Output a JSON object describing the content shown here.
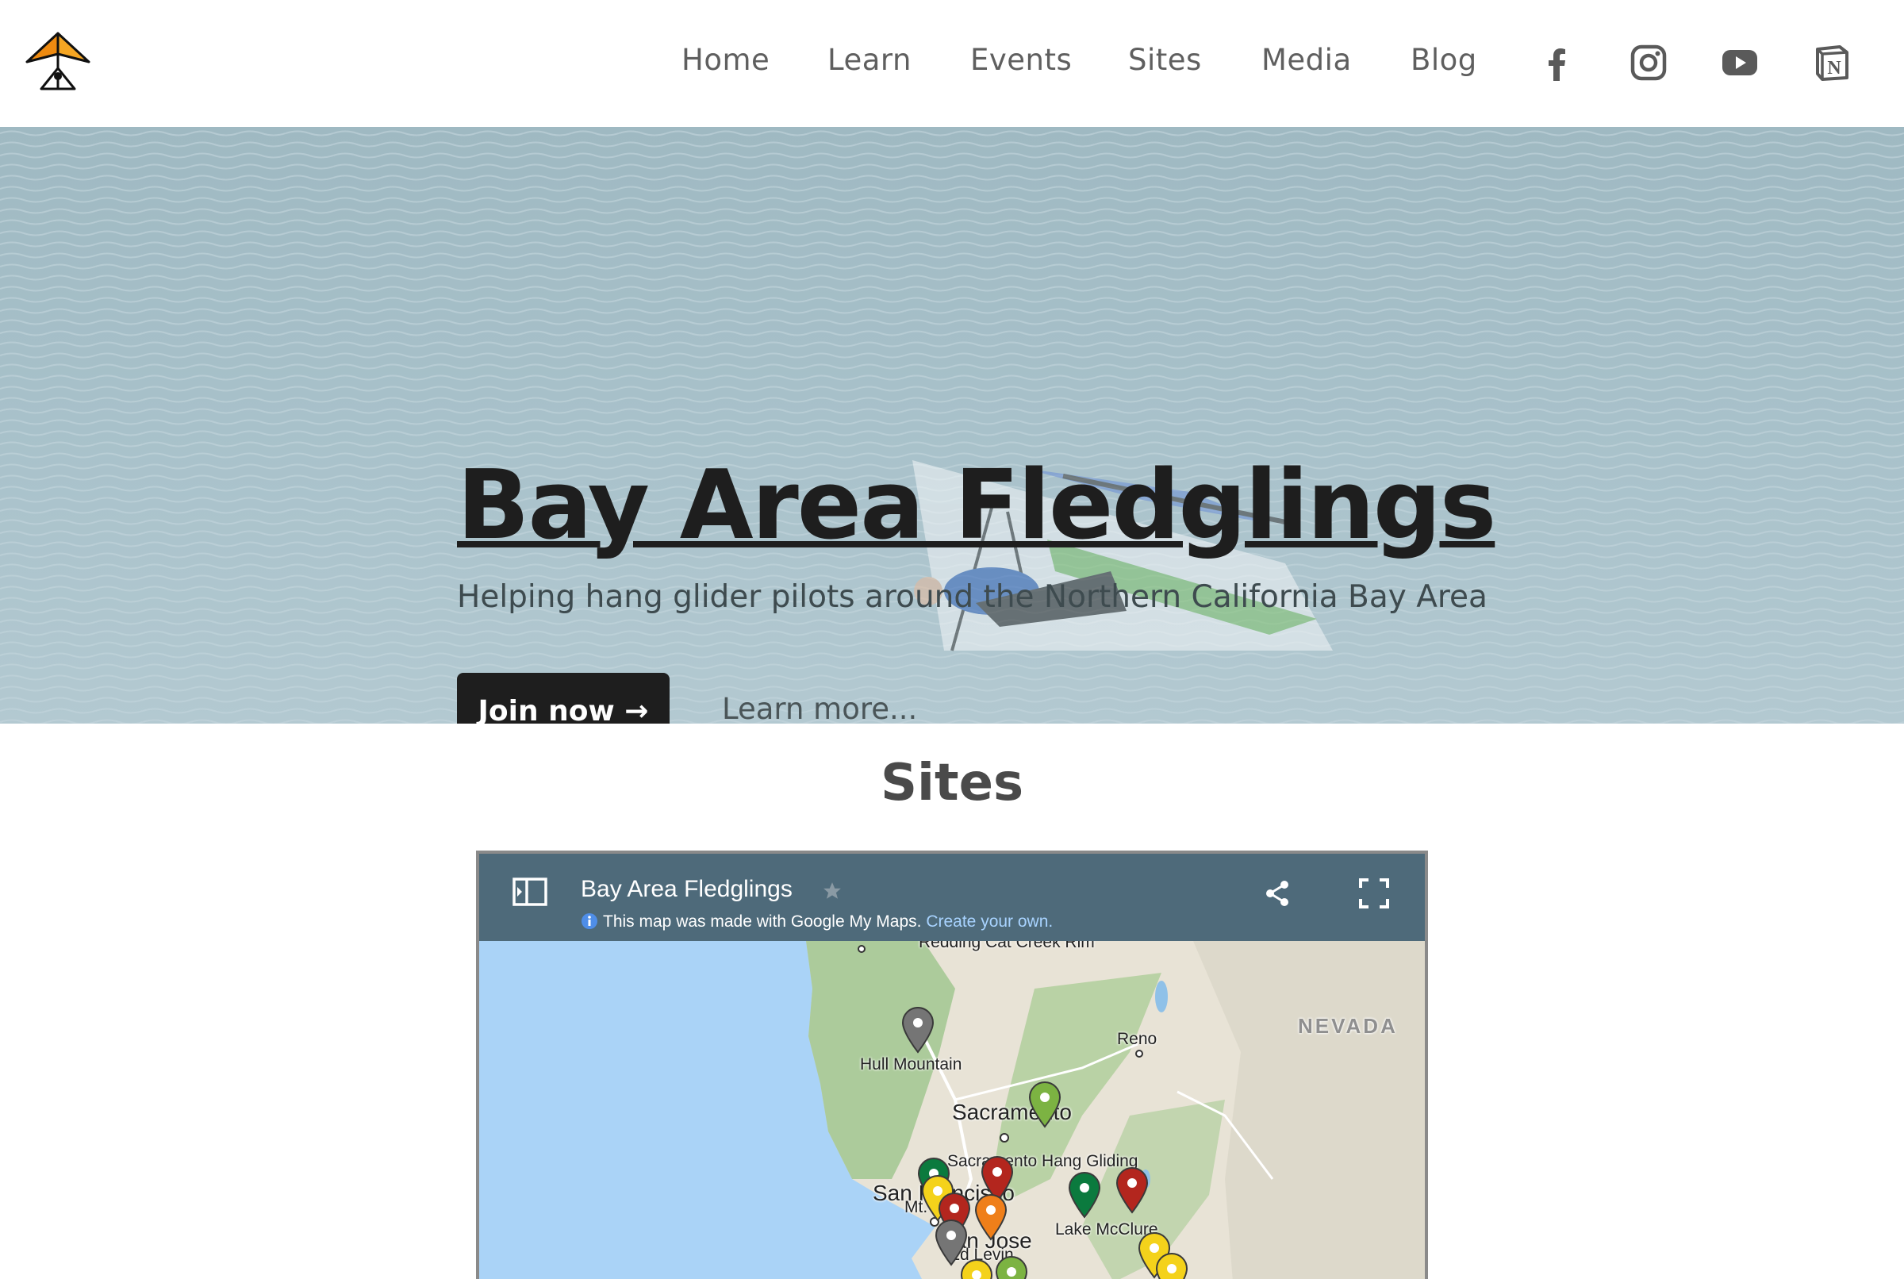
{
  "header": {
    "nav": [
      "Home",
      "Learn",
      "Events",
      "Sites",
      "Media",
      "Blog"
    ],
    "social": [
      "facebook-icon",
      "instagram-icon",
      "youtube-icon",
      "notion-icon"
    ],
    "logo": "hang-glider-logo-icon"
  },
  "hero": {
    "title": "Bay Area Fledglings",
    "subtitle": "Helping hang glider pilots around the Northern California Bay Area",
    "join_label": "Join now →",
    "learn_more_label": "Learn more..."
  },
  "sites": {
    "title": "Sites",
    "map": {
      "title": "Bay Area Fledglings",
      "info_text": "This map was made with Google My Maps.",
      "info_link": "Create your own.",
      "labels": {
        "hull": "Hull Mountain",
        "reno": "Reno",
        "nevada": "NEVADA",
        "sacramento": "Sacramento",
        "sac_hang": "Sacramento Hang Gliding",
        "san_francisco": "San Francisco",
        "mt_tam": "Mt. Tam",
        "san_jose": "San Jose",
        "ed_levin": "Ed Levin",
        "lake_mcclure": "Lake McClure",
        "top_cut": "Redding  Cat Creek Rim"
      }
    }
  },
  "colors": {
    "accent": "#1e1e1e",
    "map_header": "#4e6a7a",
    "ocean": "#aad3f7",
    "pin_green": "#7cb342",
    "pin_dark_green": "#0b7a3e",
    "pin_red": "#b3261e",
    "pin_yellow": "#f4d21b",
    "pin_orange": "#ef7f1a",
    "pin_grey": "#757575"
  }
}
